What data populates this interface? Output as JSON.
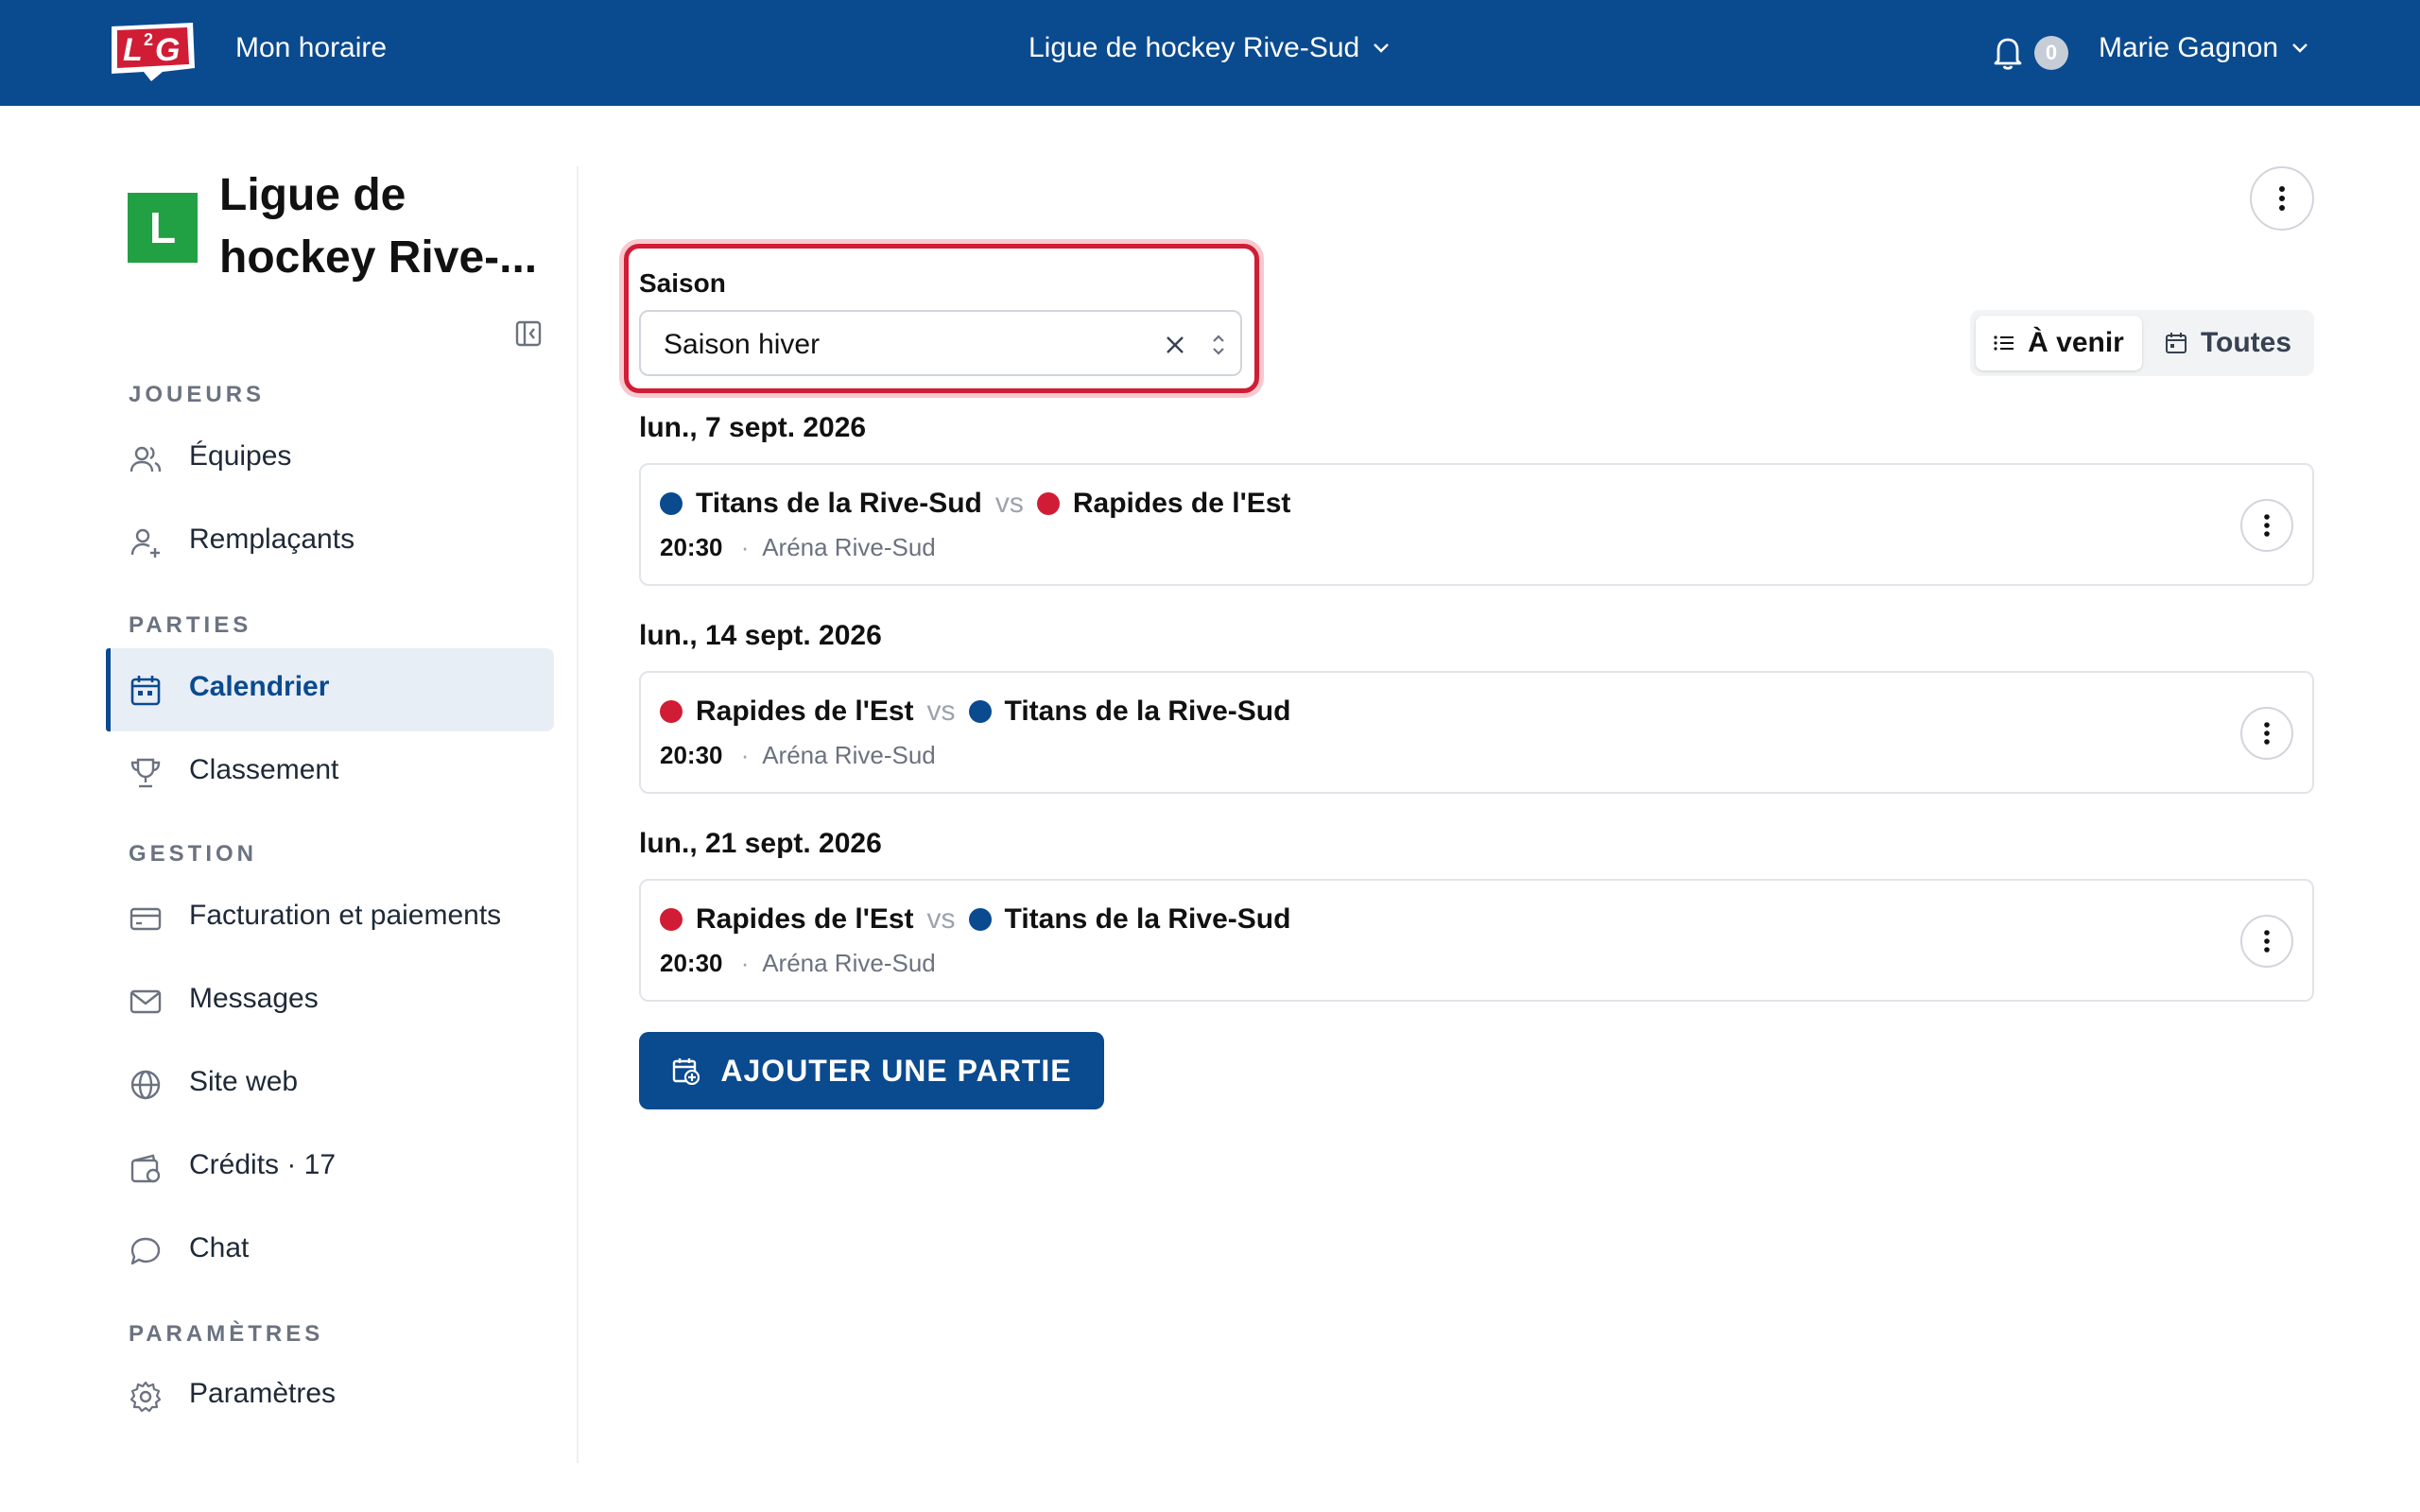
{
  "header": {
    "logo_text": "L2G",
    "my_schedule": "Mon horaire",
    "league_selector": "Ligue de hockey Rive-Sud",
    "notifications_count": "0",
    "user_name": "Marie Gagnon"
  },
  "sidebar": {
    "org_initial": "L",
    "org_name": "Ligue de hockey Rive-...",
    "sections": {
      "players": "JOUEURS",
      "games": "PARTIES",
      "management": "GESTION",
      "settings": "PARAMÈTRES"
    },
    "items": [
      {
        "label": "Équipes",
        "icon": "users-icon"
      },
      {
        "label": "Remplaçants",
        "icon": "user-plus-icon"
      },
      {
        "label": "Calendrier",
        "icon": "calendar-icon",
        "active": true
      },
      {
        "label": "Classement",
        "icon": "trophy-icon"
      },
      {
        "label": "Facturation et paiements",
        "icon": "credit-card-icon"
      },
      {
        "label": "Messages",
        "icon": "mail-icon"
      },
      {
        "label": "Site web",
        "icon": "globe-icon"
      },
      {
        "label": "Crédits · 17",
        "icon": "wallet-icon"
      },
      {
        "label": "Chat",
        "icon": "chat-icon"
      },
      {
        "label": "Paramètres",
        "icon": "gear-icon"
      }
    ]
  },
  "filters": {
    "season_label": "Saison",
    "season_value": "Saison hiver",
    "toggle_upcoming": "À venir",
    "toggle_all": "Toutes"
  },
  "games": [
    {
      "date": "lun., 7 sept. 2026",
      "home": {
        "name": "Titans de la Rive-Sud",
        "color": "#0a4a8f"
      },
      "vs": "vs",
      "away": {
        "name": "Rapides de l'Est",
        "color": "#d01d35"
      },
      "time": "20:30",
      "separator": "·",
      "venue": "Aréna Rive-Sud"
    },
    {
      "date": "lun., 14 sept. 2026",
      "home": {
        "name": "Rapides de l'Est",
        "color": "#d01d35"
      },
      "vs": "vs",
      "away": {
        "name": "Titans de la Rive-Sud",
        "color": "#0a4a8f"
      },
      "time": "20:30",
      "separator": "·",
      "venue": "Aréna Rive-Sud"
    },
    {
      "date": "lun., 21 sept. 2026",
      "home": {
        "name": "Rapides de l'Est",
        "color": "#d01d35"
      },
      "vs": "vs",
      "away": {
        "name": "Titans de la Rive-Sud",
        "color": "#0a4a8f"
      },
      "time": "20:30",
      "separator": "·",
      "venue": "Aréna Rive-Sud"
    }
  ],
  "actions": {
    "add_game": "AJOUTER UNE PARTIE"
  },
  "colors": {
    "brand_blue": "#0a4a8f",
    "accent_red": "#d01d35",
    "org_green": "#22a044"
  }
}
